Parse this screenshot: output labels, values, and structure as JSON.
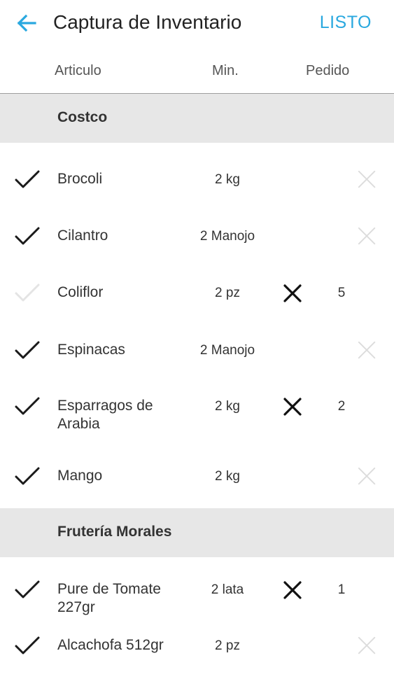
{
  "header": {
    "title": "Captura de Inventario",
    "done_label": "LISTO",
    "accent_color": "#29a8df"
  },
  "columns": {
    "item": "Articulo",
    "min": "Min.",
    "order": "Pedido"
  },
  "sections": [
    {
      "name": "Costco",
      "items": [
        {
          "name": "Brocoli",
          "min": "2 kg",
          "checked": true,
          "ordered": false,
          "order_qty": ""
        },
        {
          "name": "Cilantro",
          "min": "2 Manojo",
          "checked": true,
          "ordered": false,
          "order_qty": ""
        },
        {
          "name": "Coliflor",
          "min": "2 pz",
          "checked": false,
          "ordered": true,
          "order_qty": "5"
        },
        {
          "name": "Espinacas",
          "min": "2 Manojo",
          "checked": true,
          "ordered": false,
          "order_qty": ""
        },
        {
          "name": "Esparragos de Arabia",
          "min": "2 kg",
          "checked": true,
          "ordered": true,
          "order_qty": "2"
        },
        {
          "name": "Mango",
          "min": "2 kg",
          "checked": true,
          "ordered": false,
          "order_qty": ""
        }
      ]
    },
    {
      "name": "Frutería Morales",
      "items": [
        {
          "name": "Pure de Tomate 227gr",
          "min": "2 lata",
          "checked": true,
          "ordered": true,
          "order_qty": "1"
        },
        {
          "name": "Alcachofa 512gr",
          "min": "2 pz",
          "checked": true,
          "ordered": false,
          "order_qty": ""
        }
      ]
    }
  ],
  "icons": {
    "back": "arrow-left-icon",
    "check": "checkmark-icon",
    "ordered": "x-mark-icon",
    "clear": "clear-icon"
  }
}
